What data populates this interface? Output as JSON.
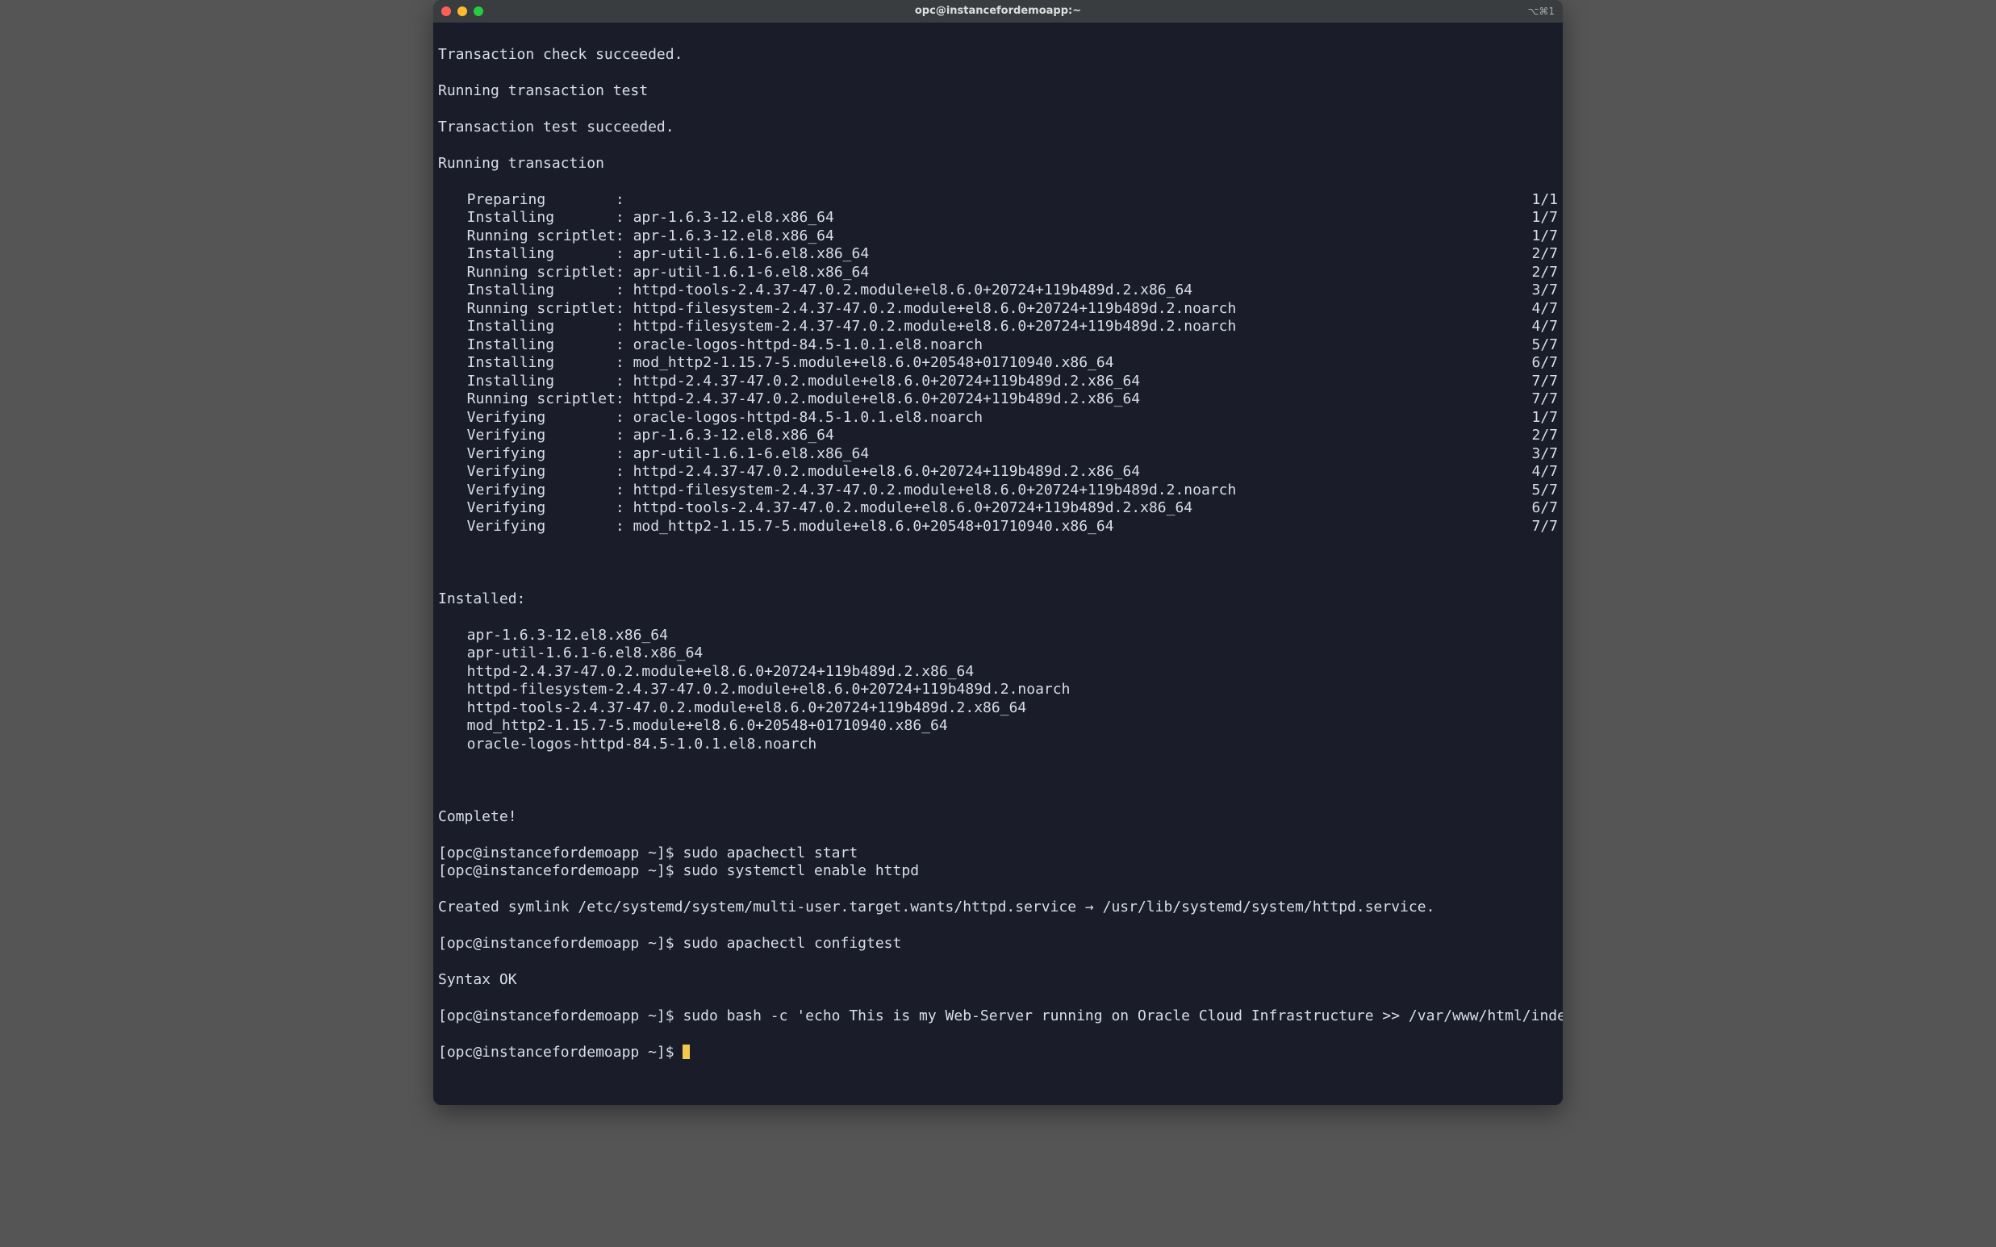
{
  "window": {
    "title": "opc@instancefordemoapp:~",
    "shortcut_hint": "⌥⌘1"
  },
  "colors": {
    "red": "#ff5f57",
    "yellow": "#ffbd2e",
    "green": "#28ca42",
    "bg": "#1a1d29",
    "fg": "#d8dee9",
    "cursor": "#f2c94c"
  },
  "output": {
    "header1": "Transaction check succeeded.",
    "header2": "Running transaction test",
    "header3": "Transaction test succeeded.",
    "header4": "Running transaction",
    "steps": [
      {
        "label": "Preparing        :",
        "pkg": "",
        "count": "1/1"
      },
      {
        "label": "Installing       :",
        "pkg": "apr-1.6.3-12.el8.x86_64",
        "count": "1/7"
      },
      {
        "label": "Running scriptlet:",
        "pkg": "apr-1.6.3-12.el8.x86_64",
        "count": "1/7"
      },
      {
        "label": "Installing       :",
        "pkg": "apr-util-1.6.1-6.el8.x86_64",
        "count": "2/7"
      },
      {
        "label": "Running scriptlet:",
        "pkg": "apr-util-1.6.1-6.el8.x86_64",
        "count": "2/7"
      },
      {
        "label": "Installing       :",
        "pkg": "httpd-tools-2.4.37-47.0.2.module+el8.6.0+20724+119b489d.2.x86_64",
        "count": "3/7"
      },
      {
        "label": "Running scriptlet:",
        "pkg": "httpd-filesystem-2.4.37-47.0.2.module+el8.6.0+20724+119b489d.2.noarch",
        "count": "4/7"
      },
      {
        "label": "Installing       :",
        "pkg": "httpd-filesystem-2.4.37-47.0.2.module+el8.6.0+20724+119b489d.2.noarch",
        "count": "4/7"
      },
      {
        "label": "Installing       :",
        "pkg": "oracle-logos-httpd-84.5-1.0.1.el8.noarch",
        "count": "5/7"
      },
      {
        "label": "Installing       :",
        "pkg": "mod_http2-1.15.7-5.module+el8.6.0+20548+01710940.x86_64",
        "count": "6/7"
      },
      {
        "label": "Installing       :",
        "pkg": "httpd-2.4.37-47.0.2.module+el8.6.0+20724+119b489d.2.x86_64",
        "count": "7/7"
      },
      {
        "label": "Running scriptlet:",
        "pkg": "httpd-2.4.37-47.0.2.module+el8.6.0+20724+119b489d.2.x86_64",
        "count": "7/7"
      },
      {
        "label": "Verifying        :",
        "pkg": "oracle-logos-httpd-84.5-1.0.1.el8.noarch",
        "count": "1/7"
      },
      {
        "label": "Verifying        :",
        "pkg": "apr-1.6.3-12.el8.x86_64",
        "count": "2/7"
      },
      {
        "label": "Verifying        :",
        "pkg": "apr-util-1.6.1-6.el8.x86_64",
        "count": "3/7"
      },
      {
        "label": "Verifying        :",
        "pkg": "httpd-2.4.37-47.0.2.module+el8.6.0+20724+119b489d.2.x86_64",
        "count": "4/7"
      },
      {
        "label": "Verifying        :",
        "pkg": "httpd-filesystem-2.4.37-47.0.2.module+el8.6.0+20724+119b489d.2.noarch",
        "count": "5/7"
      },
      {
        "label": "Verifying        :",
        "pkg": "httpd-tools-2.4.37-47.0.2.module+el8.6.0+20724+119b489d.2.x86_64",
        "count": "6/7"
      },
      {
        "label": "Verifying        :",
        "pkg": "mod_http2-1.15.7-5.module+el8.6.0+20548+01710940.x86_64",
        "count": "7/7"
      }
    ],
    "installed_header": "Installed:",
    "installed": [
      "apr-1.6.3-12.el8.x86_64",
      "apr-util-1.6.1-6.el8.x86_64",
      "httpd-2.4.37-47.0.2.module+el8.6.0+20724+119b489d.2.x86_64",
      "httpd-filesystem-2.4.37-47.0.2.module+el8.6.0+20724+119b489d.2.noarch",
      "httpd-tools-2.4.37-47.0.2.module+el8.6.0+20724+119b489d.2.x86_64",
      "mod_http2-1.15.7-5.module+el8.6.0+20548+01710940.x86_64",
      "oracle-logos-httpd-84.5-1.0.1.el8.noarch"
    ],
    "complete": "Complete!",
    "cmds": [
      {
        "prompt": "[opc@instancefordemoapp ~]$ ",
        "cmd": "sudo apachectl start"
      },
      {
        "prompt": "[opc@instancefordemoapp ~]$ ",
        "cmd": "sudo systemctl enable httpd"
      }
    ],
    "symlink": "Created symlink /etc/systemd/system/multi-user.target.wants/httpd.service → /usr/lib/systemd/system/httpd.service.",
    "cmds2": [
      {
        "prompt": "[opc@instancefordemoapp ~]$ ",
        "cmd": "sudo apachectl configtest"
      }
    ],
    "syntax_ok": "Syntax OK",
    "cmds3": [
      {
        "prompt": "[opc@instancefordemoapp ~]$ ",
        "cmd": "sudo bash -c 'echo This is my Web-Server running on Oracle Cloud Infrastructure >> /var/www/html/index.html'"
      }
    ],
    "final_prompt": "[opc@instancefordemoapp ~]$ "
  }
}
